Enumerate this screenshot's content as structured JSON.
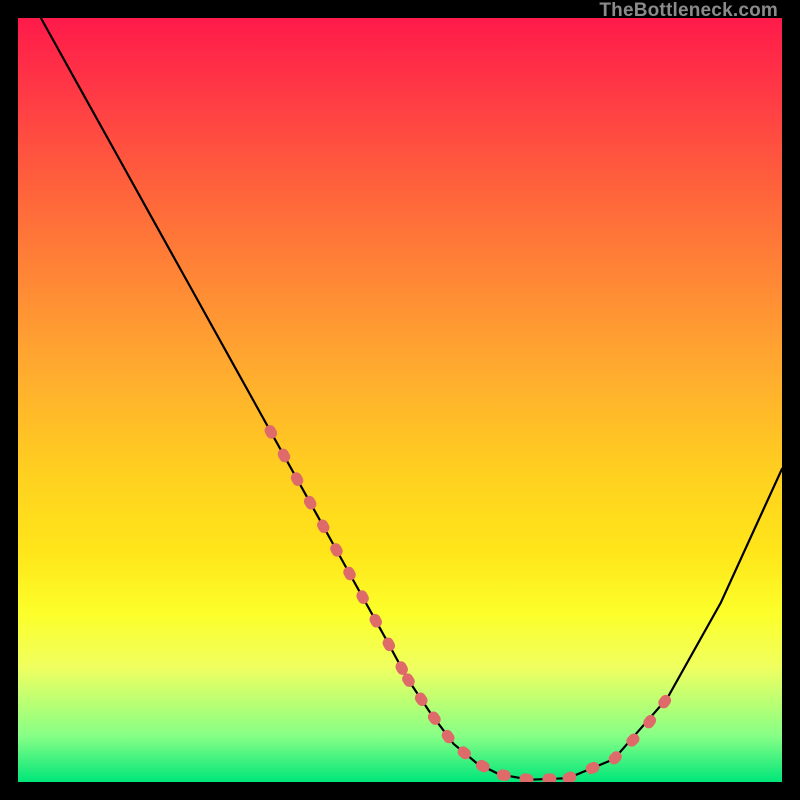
{
  "watermark": "TheBottleneck.com",
  "chart_data": {
    "type": "line",
    "title": "",
    "xlabel": "",
    "ylabel": "",
    "xlim": [
      0,
      100
    ],
    "ylim": [
      0,
      100
    ],
    "grid": false,
    "series": [
      {
        "name": "curve",
        "color": "#000000",
        "x": [
          3,
          8,
          13,
          18,
          23,
          28,
          33,
          38,
          43,
          48,
          51,
          54,
          57,
          60,
          63,
          67,
          72,
          78,
          85,
          92,
          100
        ],
        "y": [
          100,
          91,
          82,
          73,
          64,
          55,
          46,
          37,
          28,
          19,
          13.5,
          9,
          5,
          2.5,
          1,
          0.3,
          0.5,
          3,
          11,
          23.5,
          41
        ]
      },
      {
        "name": "dotted-zone",
        "color": "#e06464",
        "style": "dotted",
        "x": [
          33,
          38,
          43,
          48,
          51,
          54,
          57,
          60,
          63,
          67,
          72,
          78,
          82,
          85
        ],
        "y": [
          46,
          37,
          28,
          19,
          13.5,
          9,
          5,
          2.5,
          1,
          0.3,
          0.5,
          3,
          7,
          11
        ]
      }
    ],
    "notes": "Axes are unlabeled in the image; x and y scales are estimated as 0–100 percent based on the plot edges. The dotted-zone series overlays the lower portion of the curve with thicker salmon dashes."
  }
}
